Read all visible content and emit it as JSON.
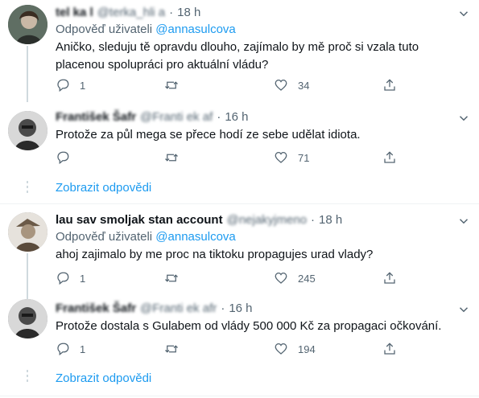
{
  "thread1": {
    "tweet1": {
      "name": "tel ka l",
      "handle": "@terka_hli a",
      "time": "18 h",
      "reply_prefix": "Odpověď uživateli",
      "reply_handle": "@annasulcova",
      "text": "Aničko, sleduju tě opravdu dlouho, zajímalo by mě proč si vzala tuto placenou spolupráci pro aktuální vládu?",
      "reply_count": "1",
      "retweet_count": "",
      "like_count": "34"
    },
    "tweet2": {
      "name": "František Šafr",
      "handle": "@Franti ek af",
      "time": "16 h",
      "text": "Protože za půl mega se přece hodí ze sebe udělat idiota.",
      "reply_count": "",
      "retweet_count": "",
      "like_count": "71"
    },
    "show_replies": "Zobrazit odpovědi"
  },
  "thread2": {
    "tweet1": {
      "name": "lau sav smoljak stan account",
      "handle": "@nejakyjmeno",
      "time": "18 h",
      "reply_prefix": "Odpověď uživateli",
      "reply_handle": "@annasulcova",
      "text": "ahoj zajimalo by me proc na tiktoku propagujes urad vlady?",
      "reply_count": "1",
      "retweet_count": "",
      "like_count": "245"
    },
    "tweet2": {
      "name": "František Šafr",
      "handle": "@Franti ek afr",
      "time": "16 h",
      "text": "Protože dostala s Gulabem od vlády 500 000 Kč za propagaci očkování.",
      "reply_count": "1",
      "retweet_count": "",
      "like_count": "194"
    },
    "show_replies": "Zobrazit odpovědi"
  },
  "icons": {
    "reply": "reply-icon",
    "retweet": "retweet-icon",
    "like": "heart-icon",
    "share": "share-icon",
    "more": "chevron-down-icon"
  },
  "colors": {
    "accent": "#1d9bf0",
    "secondary_text": "#536471",
    "divider": "#eff3f4"
  }
}
